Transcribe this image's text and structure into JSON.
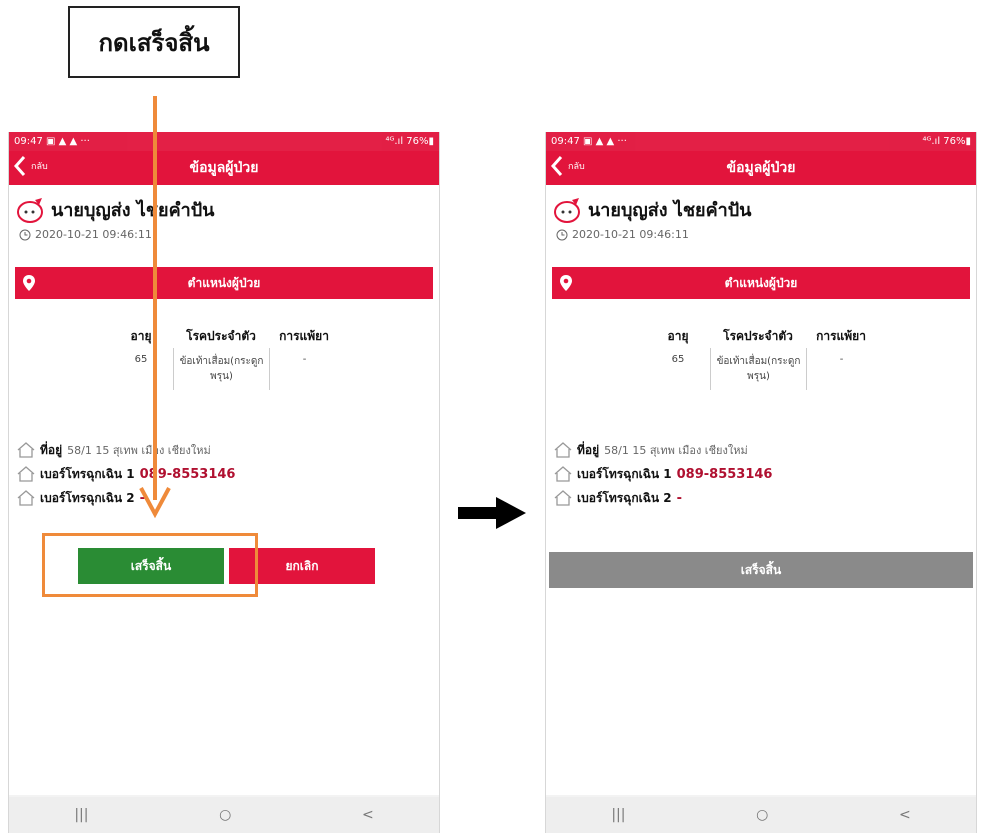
{
  "callout": {
    "text": "กดเสร็จสิ้น"
  },
  "screens": [
    {
      "status": {
        "time": "09:47 ▣ ▲ ▲ ···",
        "right": "⁴ᴳ.ıl 76%▮"
      },
      "appbar": {
        "back_label": "กลับ",
        "title": "ข้อมูลผู้ป่วย"
      },
      "patient": {
        "name": "นายบุญส่ง ไชยคำปัน",
        "datetime": "2020-10-21 09:46:11"
      },
      "location_bar": "ตำแหน่งผู้ป่วย",
      "info": {
        "headers": [
          "อายุ",
          "โรคประจำตัว",
          "การแพ้ยา"
        ],
        "values": [
          "65",
          "ข้อเท้าเสื่อม(กระดูกพรุน)",
          "-"
        ]
      },
      "address": {
        "label": "ที่อยู่",
        "value": "58/1 15 สุเทพ เมือง เชียงใหม่"
      },
      "emergency1": {
        "label": "เบอร์โทรฉุกเฉิน 1",
        "value": "089-8553146"
      },
      "emergency2": {
        "label": "เบอร์โทรฉุกเฉิน 2",
        "value": "-"
      },
      "buttons": {
        "done": "เสร็จสิ้น",
        "cancel": "ยกเลิก"
      },
      "nav": {
        "recent": "|||",
        "home": "○",
        "back": "<"
      }
    },
    {
      "status": {
        "time": "09:47 ▣ ▲ ▲ ···",
        "right": "⁴ᴳ.ıl 76%▮"
      },
      "appbar": {
        "back_label": "กลับ",
        "title": "ข้อมูลผู้ป่วย"
      },
      "patient": {
        "name": "นายบุญส่ง ไชยคำปัน",
        "datetime": "2020-10-21 09:46:11"
      },
      "location_bar": "ตำแหน่งผู้ป่วย",
      "info": {
        "headers": [
          "อายุ",
          "โรคประจำตัว",
          "การแพ้ยา"
        ],
        "values": [
          "65",
          "ข้อเท้าเสื่อม(กระดูกพรุน)",
          "-"
        ]
      },
      "address": {
        "label": "ที่อยู่",
        "value": "58/1 15 สุเทพ เมือง เชียงใหม่"
      },
      "emergency1": {
        "label": "เบอร์โทรฉุกเฉิน 1",
        "value": "089-8553146"
      },
      "emergency2": {
        "label": "เบอร์โทรฉุกเฉิน 2",
        "value": "-"
      },
      "buttons": {
        "done": "เสร็จสิ้น"
      },
      "nav": {
        "recent": "|||",
        "home": "○",
        "back": "<"
      }
    }
  ],
  "colors": {
    "primary": "#e2143c",
    "done_green": "#2a8c34",
    "done_gray": "#8a8a8a",
    "annotation_orange": "#ef8a3a"
  }
}
